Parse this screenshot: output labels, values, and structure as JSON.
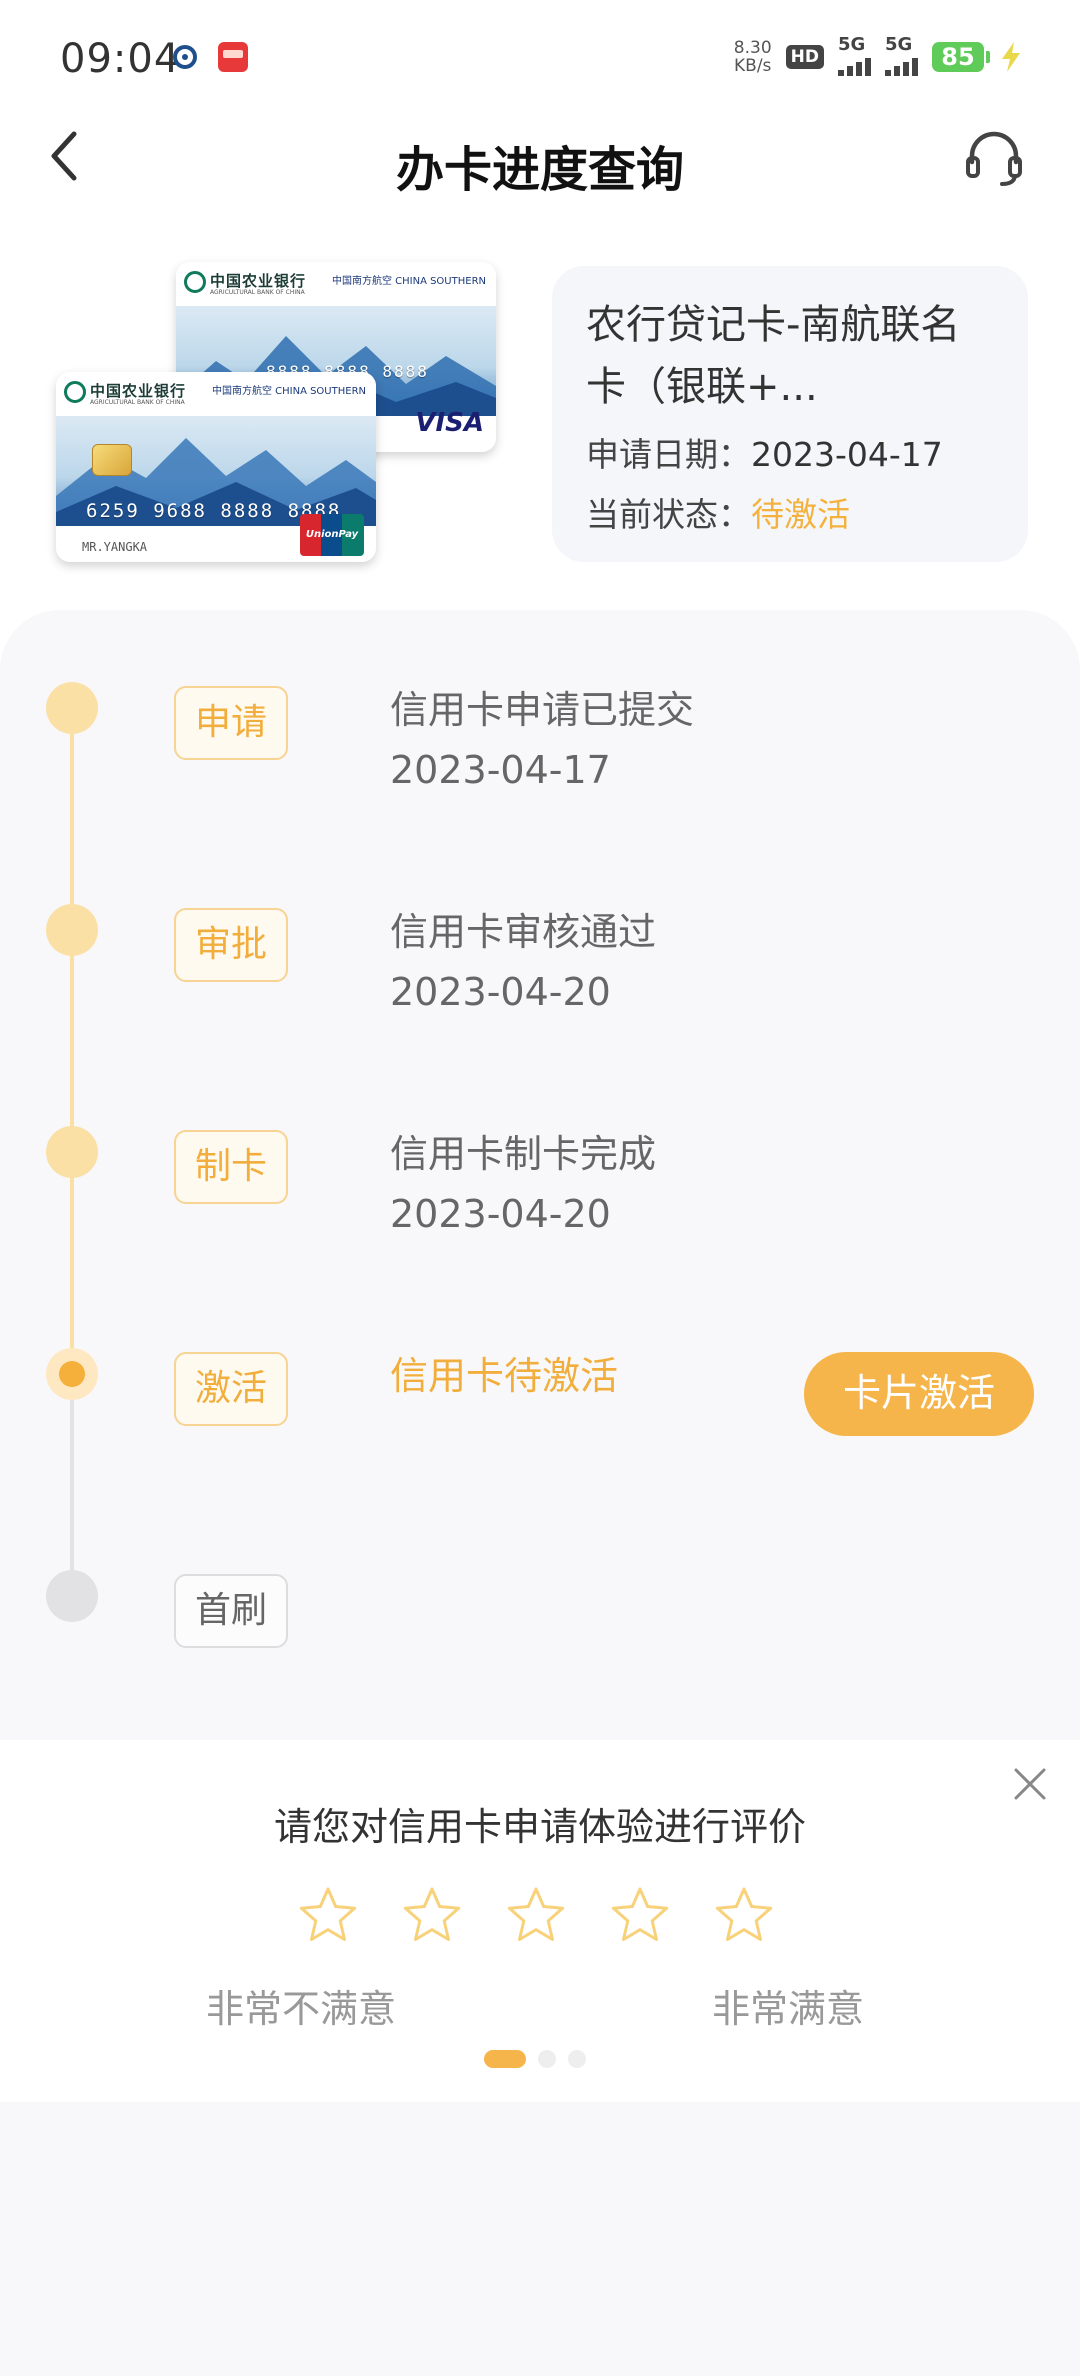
{
  "status_bar": {
    "time": "09:04",
    "net_speed_value": "8.30",
    "net_speed_unit": "KB/s",
    "hd_badge": "HD",
    "sim1_label": "5G",
    "sim2_label": "5G",
    "battery": "85"
  },
  "nav": {
    "title": "办卡进度查询"
  },
  "card": {
    "name": "农行贷记卡-南航联名卡（银联+...",
    "apply_date_label": "申请日期：",
    "apply_date": "2023-04-17",
    "status_label": "当前状态：",
    "status": "待激活",
    "art": {
      "bank_cn": "中国农业银行",
      "bank_en": "AGRICULTURAL BANK OF CHINA",
      "airline": "中国南方航空 CHINA SOUTHERN",
      "front_number": "6259 9688 8888 8888",
      "back_number": "8888 8888 8888",
      "holder": "MR.YANGKA",
      "visa": "VISA",
      "unionpay": "UnionPay"
    }
  },
  "progress": {
    "steps": [
      {
        "tag": "申请",
        "title": "信用卡申请已提交",
        "date": "2023-04-17",
        "state": "done"
      },
      {
        "tag": "审批",
        "title": "信用卡审核通过",
        "date": "2023-04-20",
        "state": "done"
      },
      {
        "tag": "制卡",
        "title": "信用卡制卡完成",
        "date": "2023-04-20",
        "state": "done"
      },
      {
        "tag": "激活",
        "title": "信用卡待激活",
        "date": "",
        "state": "current"
      },
      {
        "tag": "首刷",
        "title": "",
        "date": "",
        "state": "todo"
      }
    ],
    "activate_button": "卡片激活"
  },
  "rating": {
    "question": "请您对信用卡申请体验进行评价",
    "star_count": 5,
    "selected_stars": 0,
    "low_label": "非常不满意",
    "high_label": "非常满意",
    "pages": 3,
    "current_page": 1
  },
  "colors": {
    "accent": "#f6b54a",
    "accent_text": "#f2ae3c",
    "timeline_done": "#fbe0a6",
    "timeline_todo": "#e2e2e4",
    "panel_bg": "#f8f8fa"
  },
  "icons": {
    "back": "chevron-left-icon",
    "service": "headset-icon",
    "close": "close-icon",
    "star": "star-outline-icon"
  }
}
